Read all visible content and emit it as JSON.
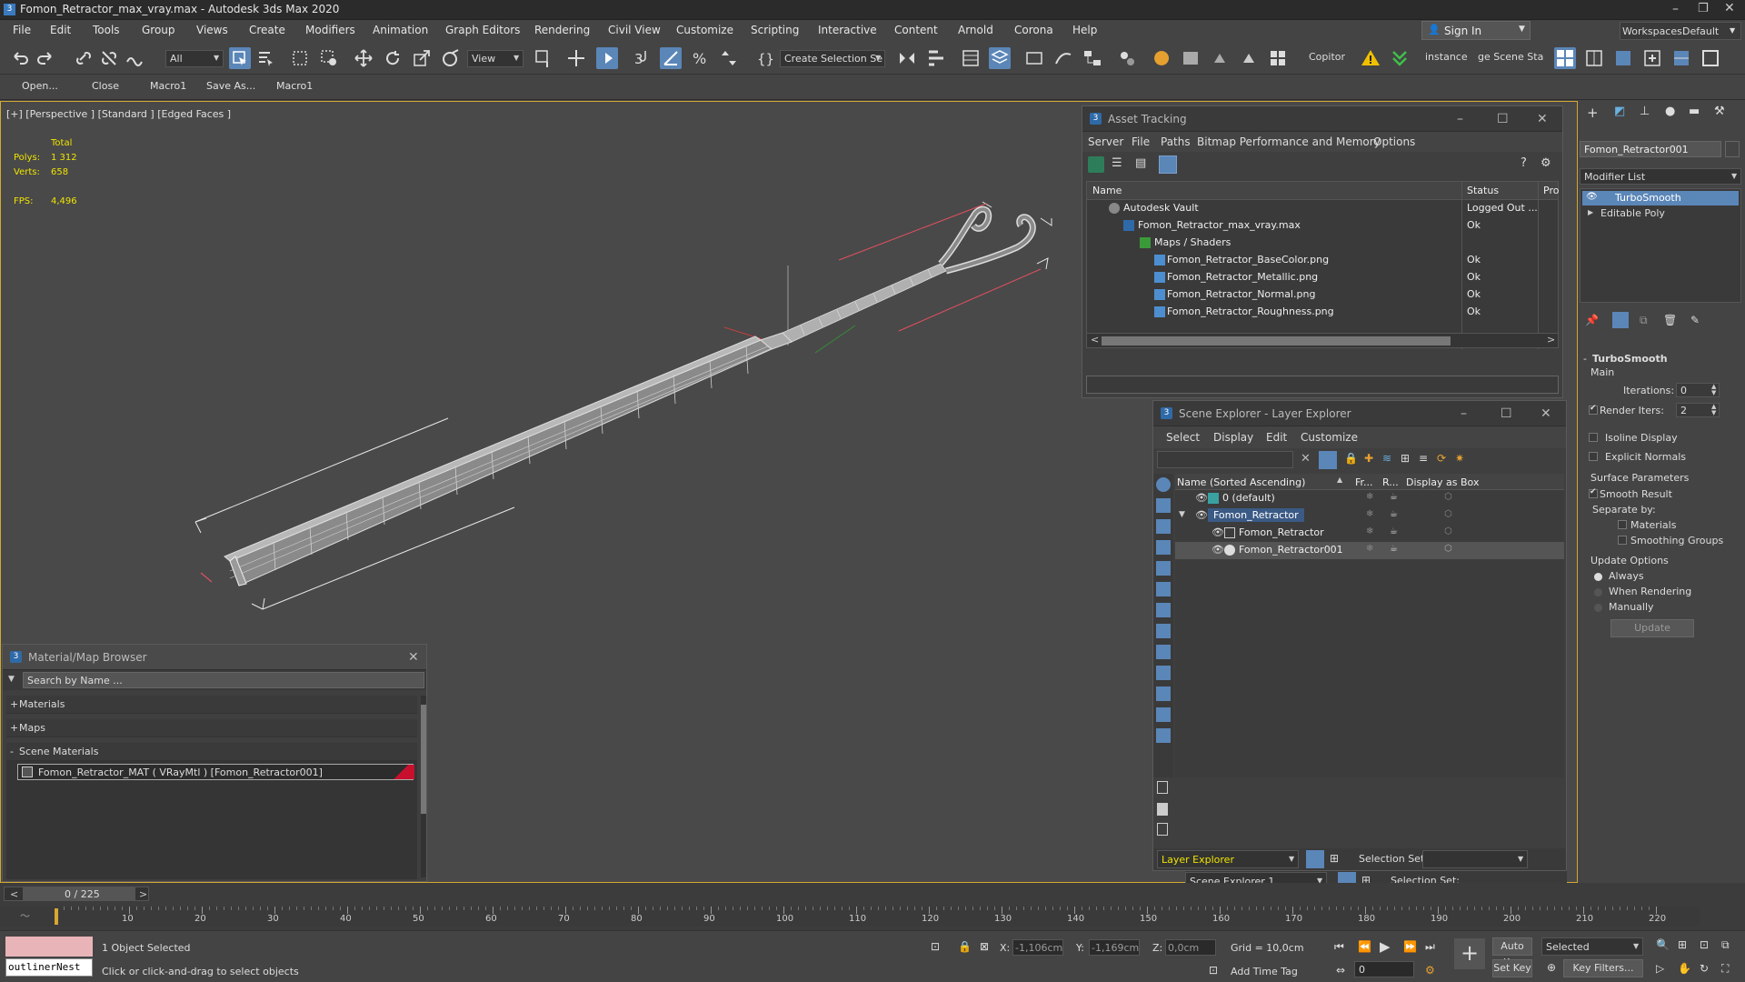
{
  "app": {
    "title": "Fomon_Retractor_max_vray.max - Autodesk 3ds Max 2020",
    "sign_in": "Sign In",
    "workspaces_label": "Workspaces:",
    "workspace_value": "Default"
  },
  "menu": [
    "File",
    "Edit",
    "Tools",
    "Group",
    "Views",
    "Create",
    "Modifiers",
    "Animation",
    "Graph Editors",
    "Rendering",
    "Civil View",
    "Customize",
    "Scripting",
    "Interactive",
    "Content",
    "Arnold",
    "Corona",
    "Help"
  ],
  "toolbar": {
    "filter_value": "All",
    "refcoord_value": "View",
    "selection_set_placeholder": "Create Selection Se",
    "copitor_label": "Copitor",
    "instance_label": "instance",
    "scene_stat_label": "ge Scene Stat"
  },
  "toolbar2": [
    "Open...",
    "Close",
    "Macro1",
    "Save As...",
    "Macro1"
  ],
  "viewport": {
    "label": "[+] [Perspective ] [Standard ] [Edged Faces ]",
    "stats_total_label": "Total",
    "polys_label": "Polys:",
    "polys_value": "1 312",
    "verts_label": "Verts:",
    "verts_value": "658",
    "fps_label": "FPS:",
    "fps_value": "4,496"
  },
  "asset_tracking": {
    "title": "Asset Tracking",
    "menu": [
      "Server",
      "File",
      "Paths",
      "Bitmap Performance and Memory",
      "Options"
    ],
    "columns": [
      "Name",
      "Status",
      "Pro"
    ],
    "rows": [
      {
        "name": "Autodesk Vault",
        "status": "Logged Out ..."
      },
      {
        "name": "Fomon_Retractor_max_vray.max",
        "status": "Ok"
      },
      {
        "name": "Maps / Shaders",
        "status": ""
      },
      {
        "name": "Fomon_Retractor_BaseColor.png",
        "status": "Ok"
      },
      {
        "name": "Fomon_Retractor_Metallic.png",
        "status": "Ok"
      },
      {
        "name": "Fomon_Retractor_Normal.png",
        "status": "Ok"
      },
      {
        "name": "Fomon_Retractor_Roughness.png",
        "status": "Ok"
      }
    ]
  },
  "scene_explorer": {
    "title": "Scene Explorer - Layer Explorer",
    "menu": [
      "Select",
      "Display",
      "Edit",
      "Customize"
    ],
    "columns": [
      "Name (Sorted Ascending)",
      "Fr...",
      "R...",
      "Display as Box"
    ],
    "rows": [
      {
        "name": "0 (default)"
      },
      {
        "name": "Fomon_Retractor"
      },
      {
        "name": "Fomon_Retractor"
      },
      {
        "name": "Fomon_Retractor001"
      }
    ],
    "explorer_value": "Layer Explorer",
    "selection_set_label": "Selection Set:",
    "explorer2_value": "Scene Explorer 1",
    "selection_set_label2": "Selection Set:"
  },
  "material_browser": {
    "title": "Material/Map Browser",
    "search_placeholder": "Search by Name ...",
    "sections": [
      "Materials",
      "Maps",
      "Scene Materials"
    ],
    "material_item": "Fomon_Retractor_MAT  ( VRayMtl )  [Fomon_Retractor001]"
  },
  "command_panel": {
    "object_name": "Fomon_Retractor001",
    "modifier_list": "Modifier List",
    "stack": [
      "TurboSmooth",
      "Editable Poly"
    ],
    "rollout_title": "TurboSmooth",
    "main_label": "Main",
    "iterations_label": "Iterations:",
    "iterations_value": "0",
    "render_iters_label": "Render Iters:",
    "render_iters_value": "2",
    "isoline_label": "Isoline Display",
    "explicit_normals_label": "Explicit Normals",
    "surface_params_label": "Surface Parameters",
    "smooth_result_label": "Smooth Result",
    "separate_by_label": "Separate by:",
    "materials_label": "Materials",
    "smoothing_groups_label": "Smoothing Groups",
    "update_options_label": "Update Options",
    "always_label": "Always",
    "when_rendering_label": "When Rendering",
    "manually_label": "Manually",
    "update_button": "Update"
  },
  "timeline": {
    "frame_counter": "0 / 225",
    "ticks": [
      "10",
      "20",
      "30",
      "40",
      "50",
      "60",
      "70",
      "80",
      "90",
      "100",
      "110",
      "120",
      "130",
      "140",
      "150",
      "160",
      "170",
      "180",
      "190",
      "200",
      "210",
      "220"
    ]
  },
  "status": {
    "script_field": "outlinerNest",
    "selected_text": "1 Object Selected",
    "prompt_text": "Click or click-and-drag to select objects",
    "x_label": "X:",
    "x_value": "-1,106cm",
    "y_label": "Y:",
    "y_value": "-1,169cm",
    "z_label": "Z:",
    "z_value": "0,0cm",
    "grid_text": "Grid = 10,0cm",
    "add_time_tag": "Add Time Tag",
    "auto_key": "Auto Key",
    "selected_value": "Selected",
    "set_key": "Set Key",
    "key_filters": "Key Filters...",
    "frame_value": "0"
  }
}
